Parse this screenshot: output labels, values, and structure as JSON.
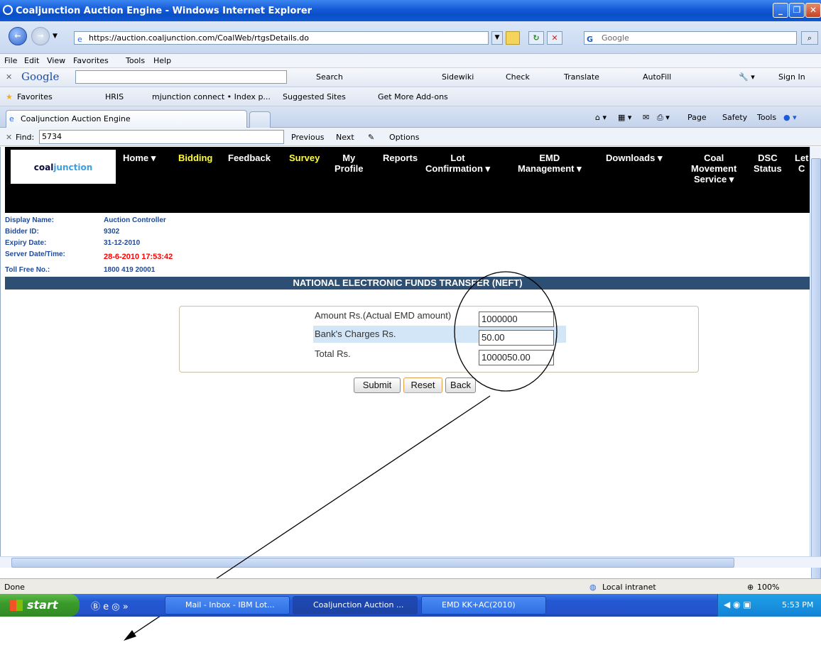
{
  "window": {
    "title": "Coaljunction Auction Engine - Windows Internet Explorer"
  },
  "address": {
    "url": "https://auction.coaljunction.com/CoalWeb/rtgsDetails.do",
    "search_placeholder": "Google"
  },
  "menu": [
    "File",
    "Edit",
    "View",
    "Favorites",
    "Tools",
    "Help"
  ],
  "google_toolbar": {
    "brand": "Google",
    "search": "Search",
    "sidewiki": "Sidewiki",
    "check": "Check",
    "translate": "Translate",
    "autofill": "AutoFill",
    "signin": "Sign In"
  },
  "favorites": {
    "label": "Favorites",
    "items": [
      "HRIS",
      "mjunction connect • Index p...",
      "Suggested Sites",
      "Get More Add-ons"
    ]
  },
  "tabs": {
    "active": "Coaljunction Auction Engine",
    "commands": [
      "Page",
      "Safety",
      "Tools"
    ]
  },
  "find": {
    "label": "Find:",
    "value": "5734",
    "previous": "Previous",
    "next": "Next",
    "options": "Options"
  },
  "site": {
    "logo": {
      "part1": "coal",
      "part2": "junction"
    },
    "nav": [
      {
        "label": "Home ▾",
        "yellow": false
      },
      {
        "label": "Bidding",
        "yellow": true
      },
      {
        "label": "Feedback",
        "yellow": false
      },
      {
        "label": "Survey",
        "yellow": true
      },
      {
        "label": "My\nProfile",
        "yellow": false
      },
      {
        "label": "Reports",
        "yellow": false
      },
      {
        "label": "Lot\nConfirmation ▾",
        "yellow": false
      },
      {
        "label": "EMD\nManagement ▾",
        "yellow": false
      },
      {
        "label": "Downloads ▾",
        "yellow": false
      },
      {
        "label": "Coal\nMovement\nService ▾",
        "yellow": false
      },
      {
        "label": "DSC\nStatus",
        "yellow": false
      },
      {
        "label": "Let\nC",
        "yellow": false
      }
    ],
    "info": {
      "display_name_label": "Display Name:",
      "display_name": "Auction Controller",
      "bidder_id_label": "Bidder ID:",
      "bidder_id": "9302",
      "expiry_label": "Expiry Date:",
      "expiry": "31-12-2010",
      "server_label": "Server Date/Time:",
      "server": "28-6-2010 17:53:42",
      "tollfree_label": "Toll Free No.:",
      "tollfree": "1800 419 20001"
    },
    "heading": "NATIONAL ELECTRONIC FUNDS TRANSFER (NEFT)",
    "form": {
      "amount_label": "Amount Rs.(Actual EMD amount)",
      "amount": "1000000",
      "charges_label": "Bank's Charges Rs.",
      "charges": "50.00",
      "total_label": "Total Rs.",
      "total": "1000050.00"
    },
    "buttons": {
      "submit": "Submit",
      "reset": "Reset",
      "back": "Back"
    }
  },
  "status": {
    "text": "Done",
    "zone": "Local intranet",
    "zoom": "100%"
  },
  "taskbar": {
    "start": "start",
    "tasks": [
      "Mail - Inbox - IBM Lot...",
      "Coaljunction Auction ...",
      "EMD KK+AC(2010)"
    ],
    "clock": "5:53 PM"
  }
}
